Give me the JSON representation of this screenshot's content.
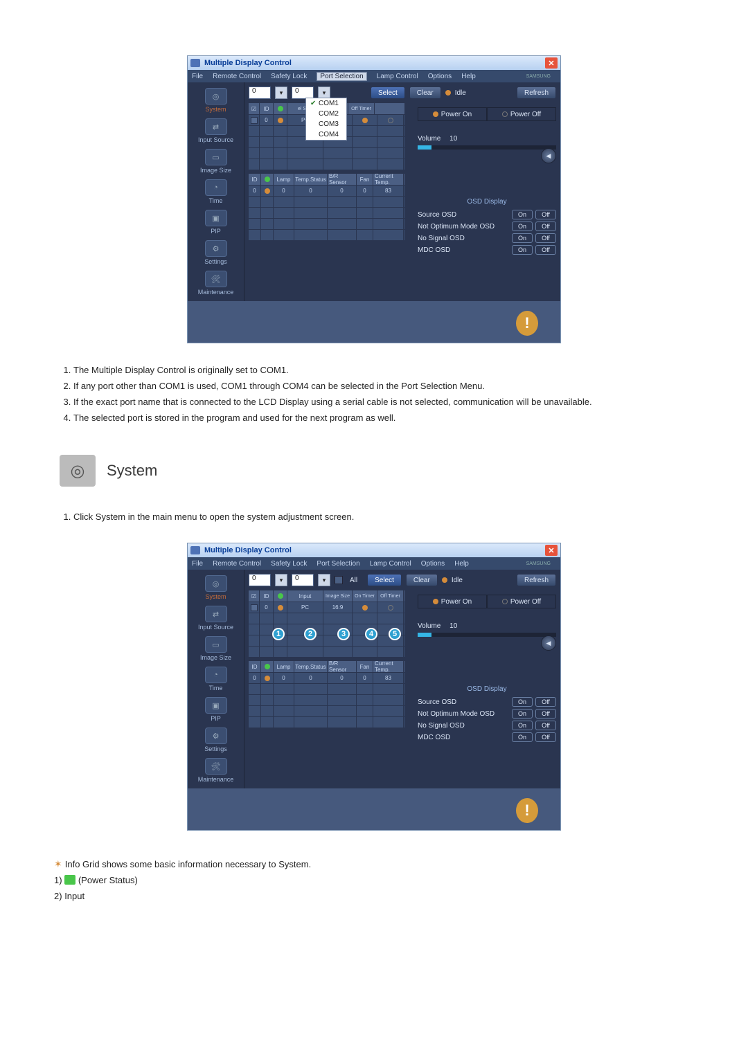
{
  "window": {
    "title": "Multiple Display Control",
    "close_glyph": "✕",
    "brand": "SAMSUNG"
  },
  "menu": {
    "file": "File",
    "remote": "Remote Control",
    "safety": "Safety Lock",
    "port": "Port Selection",
    "lamp": "Lamp Control",
    "options": "Options",
    "help": "Help"
  },
  "port_dropdown": {
    "com1": "COM1",
    "com2": "COM2",
    "com3": "COM3",
    "com4": "COM4",
    "chk": "✔"
  },
  "nav": {
    "system": "System",
    "input": "Input Source",
    "image": "Image Size",
    "time": "Time",
    "pip": "PIP",
    "settings": "Settings",
    "maint": "Maintenance"
  },
  "top": {
    "field1": "0",
    "field2": "0",
    "select": "Select",
    "clear": "Clear",
    "idle": "Idle",
    "refresh": "Refresh",
    "all": "All"
  },
  "grid1": {
    "h_chk": "☑",
    "h_id": "ID",
    "h_pw": "",
    "h_input": "Input",
    "h_size": "Image Size",
    "h_on": "On Timer",
    "h_off": "Off Timer",
    "r_id": "0",
    "r_input": "PC",
    "r_size": "16:9"
  },
  "grid2": {
    "h_id": "ID",
    "h_pw": "",
    "h_lamp": "Lamp",
    "h_temp": "Temp.Status",
    "h_br": "B/R Sensor",
    "h_fan": "Fan",
    "h_ct": "Current Temp.",
    "r_id": "0",
    "r_lamp": "0",
    "r_temp": "0",
    "r_br": "0",
    "r_fan": "0",
    "r_ct": "83"
  },
  "panel": {
    "power_on": "Power On",
    "power_off": "Power Off",
    "volume_label": "Volume",
    "volume_value": "10",
    "osd_title": "OSD Display",
    "source_osd": "Source OSD",
    "not_optimum": "Not Optimum Mode OSD",
    "no_signal": "No Signal OSD",
    "mdc_osd": "MDC OSD",
    "on": "On",
    "off": "Off",
    "warn": "!"
  },
  "explain": {
    "i1": "The Multiple Display Control is originally set to COM1.",
    "i2": "If any port other than COM1 is used, COM1 through COM4 can be selected in the Port Selection Menu.",
    "i3": "If the exact port name that is connected to the LCD Display using a serial cable is not selected, communication will be unavailable.",
    "i4": "The selected port is stored in the program and used for the next program as well."
  },
  "section": {
    "title": "System",
    "note1": "Click System in the main menu to open the system adjustment screen."
  },
  "callouts": {
    "c1": "1",
    "c2": "2",
    "c3": "3",
    "c4": "4",
    "c5": "5"
  },
  "star_notes": {
    "line1": "Info Grid shows some basic information necessary to System.",
    "line2_num": "1)",
    "line2_txt": "(Power Status)",
    "line3_num": "2)",
    "line3_txt": "Input"
  }
}
